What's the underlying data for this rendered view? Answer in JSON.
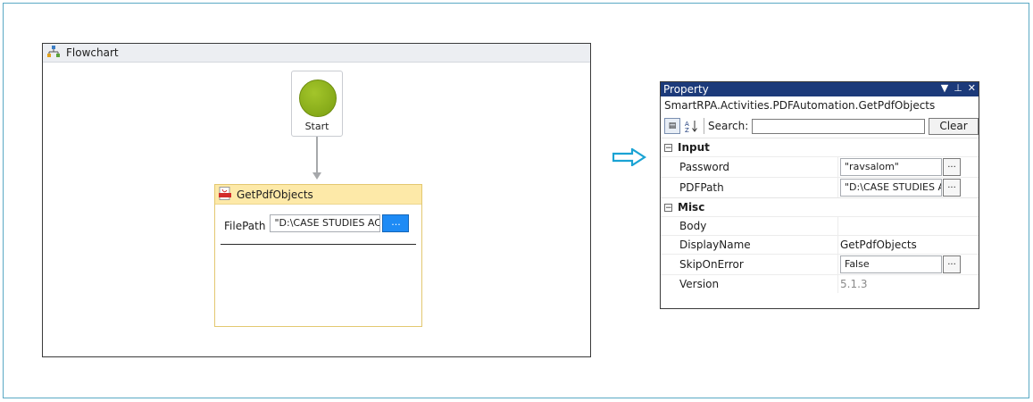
{
  "flowchart": {
    "title": "Flowchart",
    "start_label": "Start",
    "activity": {
      "title": "GetPdfObjects",
      "filepath_label": "FilePath",
      "filepath_value": "\"D:\\CASE STUDIES AC",
      "browse_label": "..."
    }
  },
  "property_panel": {
    "title": "Property",
    "subtitle": "SmartRPA.Activities.PDFAutomation.GetPdfObjects",
    "search_label": "Search:",
    "search_value": "",
    "clear_label": "Clear",
    "categories": [
      {
        "name": "Input",
        "props": [
          {
            "name": "Password",
            "value": "\"ravsalom\""
          },
          {
            "name": "PDFPath",
            "value": "\"D:\\CASE STUDIES A"
          }
        ]
      },
      {
        "name": "Misc",
        "props": [
          {
            "name": "Body",
            "value": ""
          },
          {
            "name": "DisplayName",
            "value": "GetPdfObjects"
          },
          {
            "name": "SkipOnError",
            "value": "False"
          },
          {
            "name": "Version",
            "value": "5.1.3"
          }
        ]
      }
    ],
    "ellipsis": "..."
  },
  "colors": {
    "title_bar": "#1c3a7a",
    "start_node": "#8fb21b",
    "activity_header": "#fde9a8",
    "browse_button": "#1e8bf5",
    "arrow": "#1aa3d4"
  }
}
